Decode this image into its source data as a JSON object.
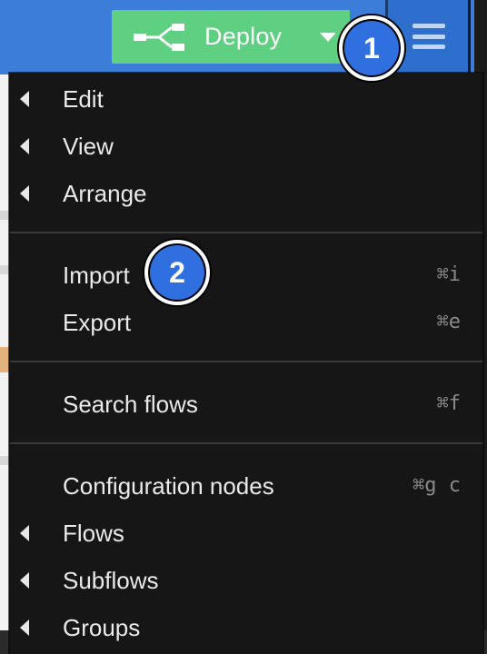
{
  "header": {
    "deploy": {
      "label": "Deploy",
      "icon": "deploy-flow-icon",
      "caret_icon": "caret-down-icon",
      "color": "#5fcf82"
    },
    "menu_button": {
      "icon": "hamburger-menu-icon",
      "color": "#2e6fcd"
    },
    "bar_color": "#3b7dd8"
  },
  "menu": {
    "items": [
      {
        "label": "Edit",
        "shortcut": "",
        "has_submenu": true
      },
      {
        "label": "View",
        "shortcut": "",
        "has_submenu": true
      },
      {
        "label": "Arrange",
        "shortcut": "",
        "has_submenu": true
      },
      {
        "label": "Import",
        "shortcut": "⌘i",
        "has_submenu": false
      },
      {
        "label": "Export",
        "shortcut": "⌘e",
        "has_submenu": false
      },
      {
        "label": "Search flows",
        "shortcut": "⌘f",
        "has_submenu": false
      },
      {
        "label": "Configuration nodes",
        "shortcut": "⌘g c",
        "has_submenu": false
      },
      {
        "label": "Flows",
        "shortcut": "",
        "has_submenu": true
      },
      {
        "label": "Subflows",
        "shortcut": "",
        "has_submenu": true
      },
      {
        "label": "Groups",
        "shortcut": "",
        "has_submenu": true
      }
    ],
    "background": "#161616"
  },
  "callouts": [
    {
      "number": "1"
    },
    {
      "number": "2"
    }
  ]
}
